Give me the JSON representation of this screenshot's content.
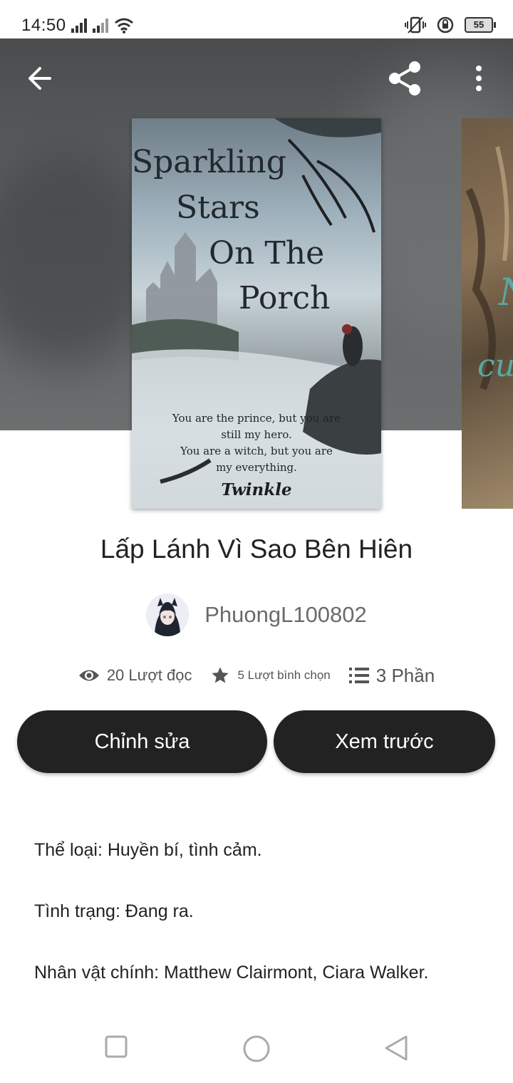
{
  "status_bar": {
    "time": "14:50",
    "battery": "55"
  },
  "book": {
    "cover": {
      "title_lines": [
        "Sparkling",
        "Stars",
        "On The",
        "Porch"
      ],
      "quote_lines": [
        "You are the prince, but you are",
        "still my hero.",
        "You are a witch, but you are",
        "my everything."
      ],
      "author_signature": "Twinkle"
    },
    "title": "Lấp Lánh Vì Sao Bên Hiên",
    "author": "PhuongL100802",
    "stats": {
      "reads": "20 Lượt đọc",
      "votes": "5 Lượt bình chọn",
      "parts": "3 Phần"
    }
  },
  "actions": {
    "edit_label": "Chỉnh sửa",
    "preview_label": "Xem trước"
  },
  "description": [
    "Thể loại: Huyền bí, tình cảm.",
    "Tình trạng: Đang ra.",
    "Nhân vật chính: Matthew Clairmont, Ciara Walker."
  ],
  "icons": {
    "back": "arrow-back-icon",
    "share": "share-icon",
    "more": "more-vert-icon",
    "reads": "eye-icon",
    "votes": "star-icon",
    "parts": "list-icon",
    "nav": [
      "square-recents-icon",
      "circle-home-icon",
      "triangle-back-icon"
    ]
  }
}
